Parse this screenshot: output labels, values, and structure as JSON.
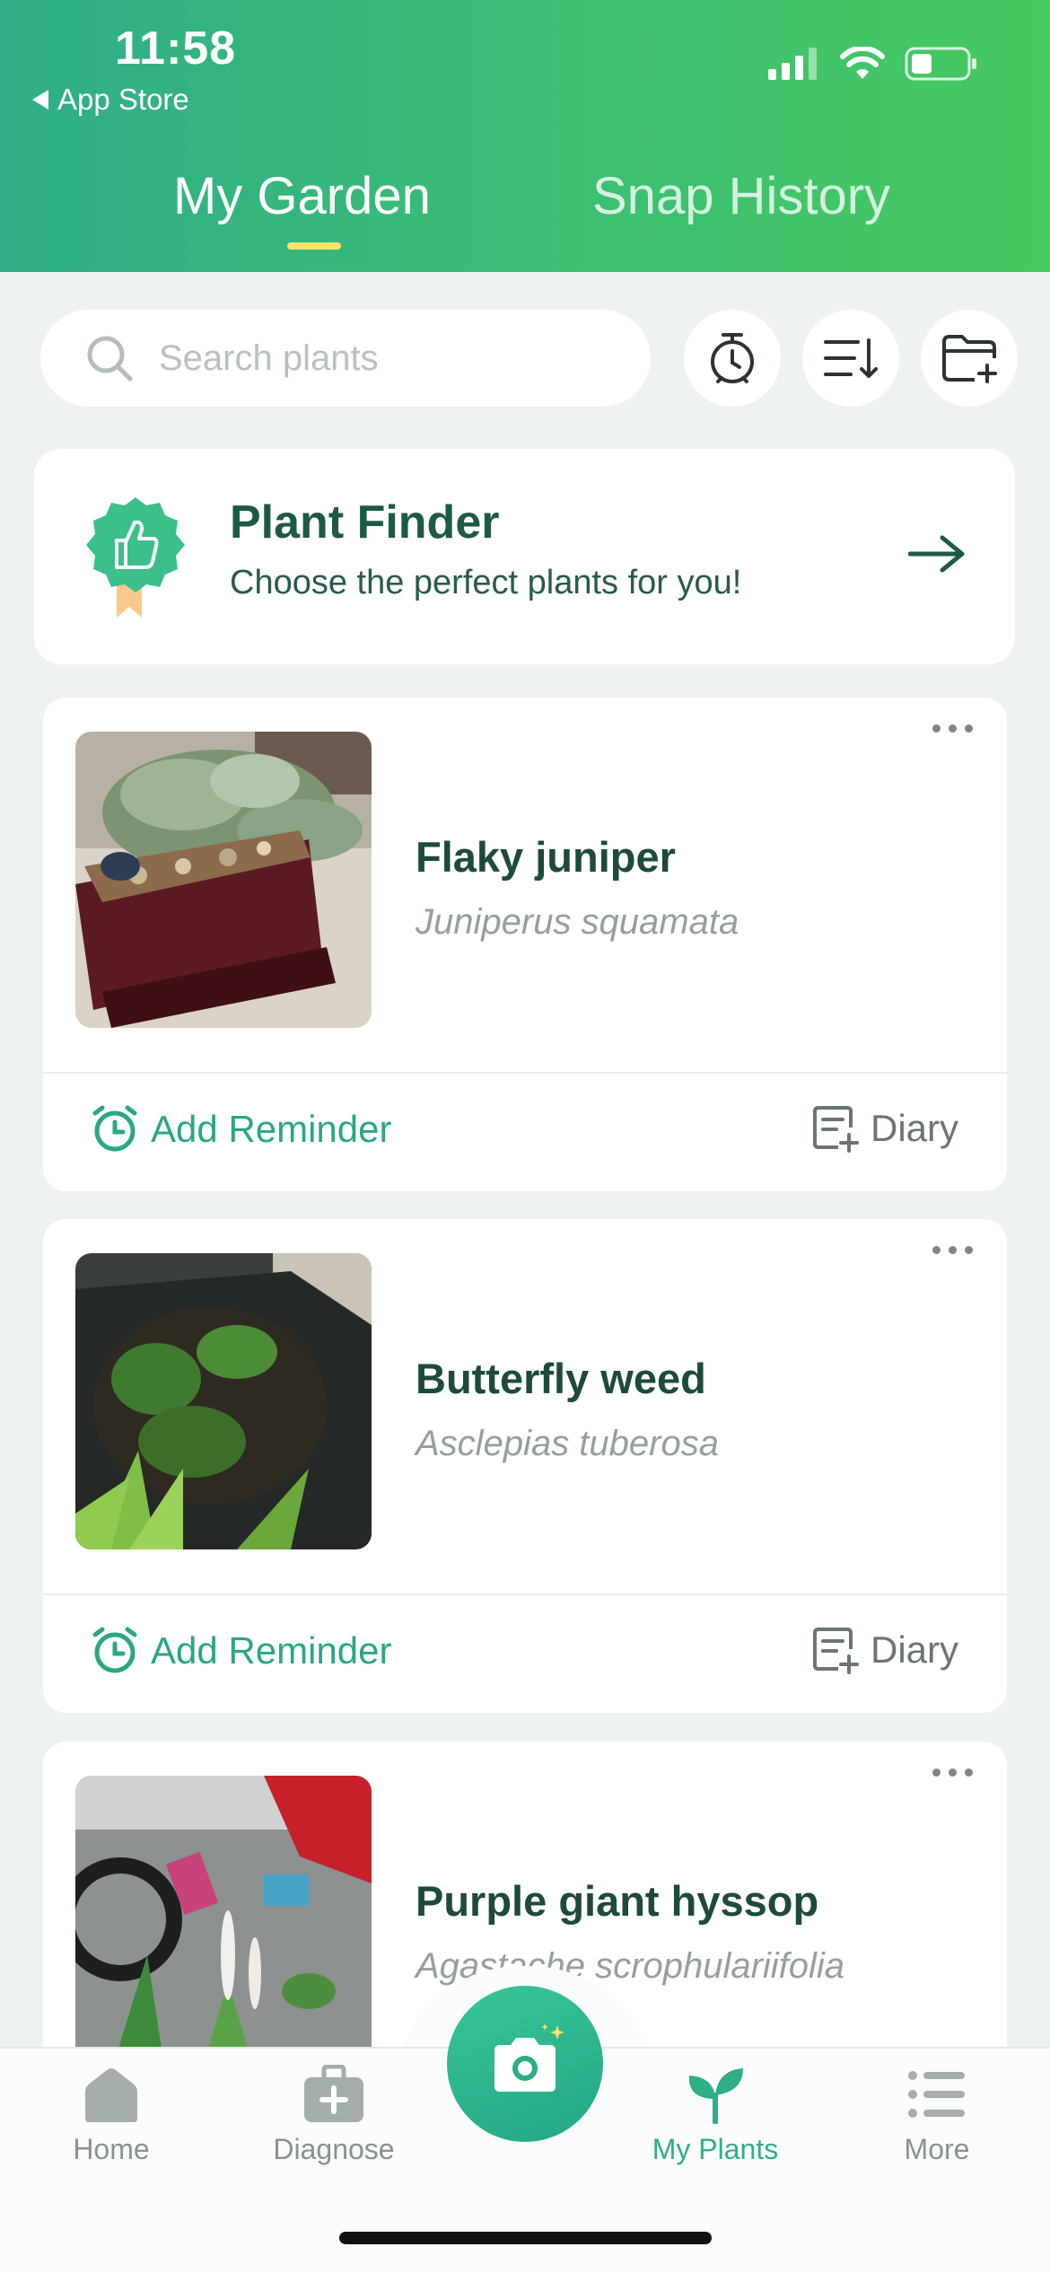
{
  "status_bar": {
    "time": "11:58",
    "back_label": "App Store"
  },
  "header": {
    "tabs": [
      {
        "label": "My Garden"
      },
      {
        "label": "Snap History"
      }
    ]
  },
  "search": {
    "placeholder": "Search plants"
  },
  "finder": {
    "title": "Plant Finder",
    "subtitle": "Choose the perfect plants for you!"
  },
  "plants": [
    {
      "name": "Flaky juniper",
      "scientific": "Juniperus squamata",
      "reminder_label": "Add Reminder",
      "diary_label": "Diary"
    },
    {
      "name": "Butterfly weed",
      "scientific": "Asclepias tuberosa",
      "reminder_label": "Add Reminder",
      "diary_label": "Diary"
    },
    {
      "name": "Purple giant hyssop",
      "scientific": "Agastache scrophulariifolia"
    }
  ],
  "nav": {
    "home": "Home",
    "diagnose": "Diagnose",
    "my_plants": "My Plants",
    "more": "More"
  },
  "colors": {
    "brand_green": "#2fae88",
    "header_gradient_end": "#46c95f",
    "tab_indicator": "#ffe26a"
  }
}
